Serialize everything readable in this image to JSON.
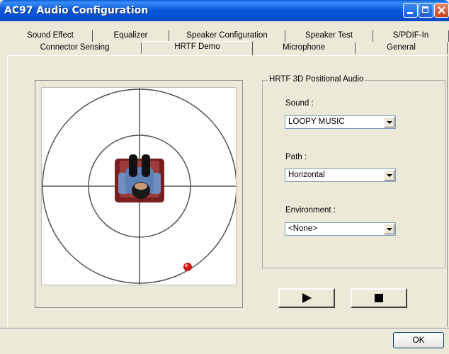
{
  "window": {
    "title": "AC97 Audio Configuration",
    "controls": [
      "minimize-icon",
      "maximize-icon",
      "close-icon"
    ]
  },
  "tabs": {
    "row1": [
      "Sound Effect",
      "Equalizer",
      "Speaker Configuration",
      "Speaker Test",
      "S/PDIF-In"
    ],
    "row2": [
      "Connector Sensing",
      "HRTF Demo",
      "Microphone",
      "General"
    ],
    "active": "HRTF Demo"
  },
  "hrtf": {
    "group_title": "HRTF 3D Positional Audio",
    "sound_label": "Sound :",
    "sound_value": "LOOPY MUSIC",
    "path_label": "Path :",
    "path_value": "Horizontal",
    "environment_label": "Environment :",
    "environment_value": "<None>",
    "play_icon": "play-icon",
    "stop_icon": "stop-icon"
  },
  "footer": {
    "ok_label": "OK"
  },
  "colors": {
    "title_bar": "#0a5fd8",
    "dialog_bg": "#ece9d8",
    "sound_source": "#d21a1a"
  }
}
